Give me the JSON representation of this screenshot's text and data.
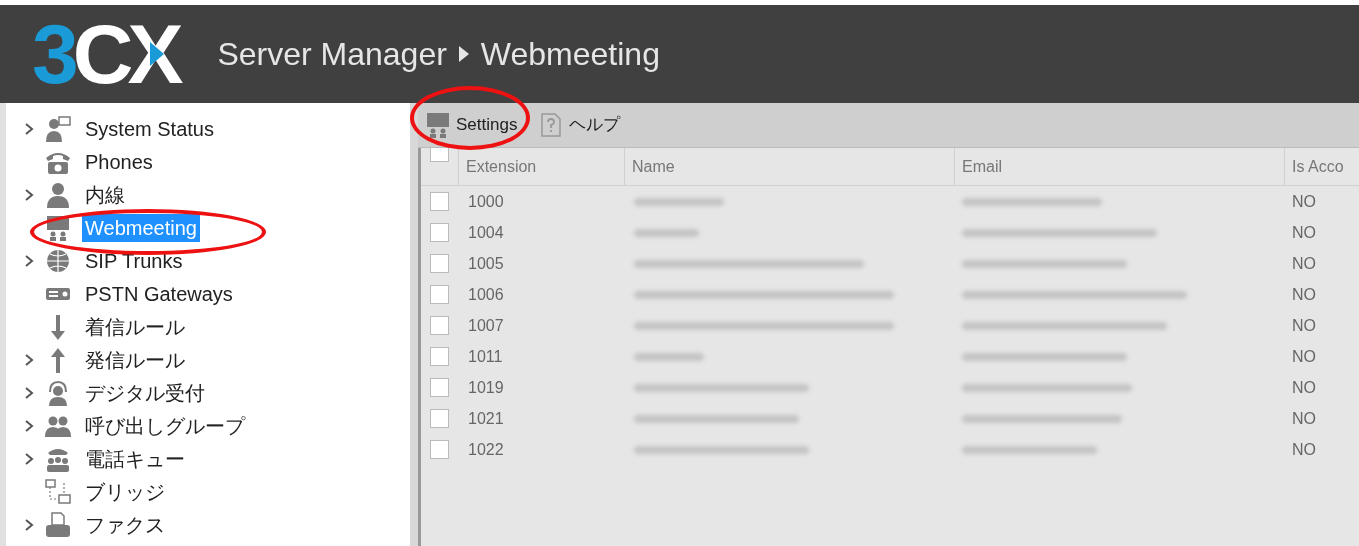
{
  "header": {
    "logo": {
      "accent": "3",
      "rest": "CX"
    },
    "breadcrumb": [
      "Server Manager",
      "Webmeeting"
    ]
  },
  "sidebar": {
    "items": [
      {
        "label": "System Status",
        "expandable": true,
        "selected": false
      },
      {
        "label": "Phones",
        "expandable": false,
        "selected": false
      },
      {
        "label": "内線",
        "expandable": true,
        "selected": false
      },
      {
        "label": "Webmeeting",
        "expandable": false,
        "selected": true
      },
      {
        "label": "SIP Trunks",
        "expandable": true,
        "selected": false
      },
      {
        "label": "PSTN Gateways",
        "expandable": false,
        "selected": false
      },
      {
        "label": "着信ルール",
        "expandable": false,
        "selected": false
      },
      {
        "label": "発信ルール",
        "expandable": true,
        "selected": false
      },
      {
        "label": "デジタル受付",
        "expandable": true,
        "selected": false
      },
      {
        "label": "呼び出しグループ",
        "expandable": true,
        "selected": false
      },
      {
        "label": "電話キュー",
        "expandable": true,
        "selected": false
      },
      {
        "label": "ブリッジ",
        "expandable": false,
        "selected": false
      },
      {
        "label": "ファクス",
        "expandable": true,
        "selected": false
      }
    ]
  },
  "toolbar": [
    {
      "label": "Settings"
    },
    {
      "label": "ヘルプ"
    }
  ],
  "table": {
    "columns": [
      "Extension",
      "Name",
      "Email",
      "Is Acco"
    ],
    "header_checked": false,
    "rows": [
      {
        "extension": "1000",
        "is_account": "NO",
        "checked": false
      },
      {
        "extension": "1004",
        "is_account": "NO",
        "checked": false
      },
      {
        "extension": "1005",
        "is_account": "NO",
        "checked": false
      },
      {
        "extension": "1006",
        "is_account": "NO",
        "checked": false
      },
      {
        "extension": "1007",
        "is_account": "NO",
        "checked": false
      },
      {
        "extension": "1011",
        "is_account": "NO",
        "checked": false
      },
      {
        "extension": "1019",
        "is_account": "NO",
        "checked": false
      },
      {
        "extension": "1021",
        "is_account": "NO",
        "checked": false
      },
      {
        "extension": "1022",
        "is_account": "NO",
        "checked": false
      }
    ]
  }
}
